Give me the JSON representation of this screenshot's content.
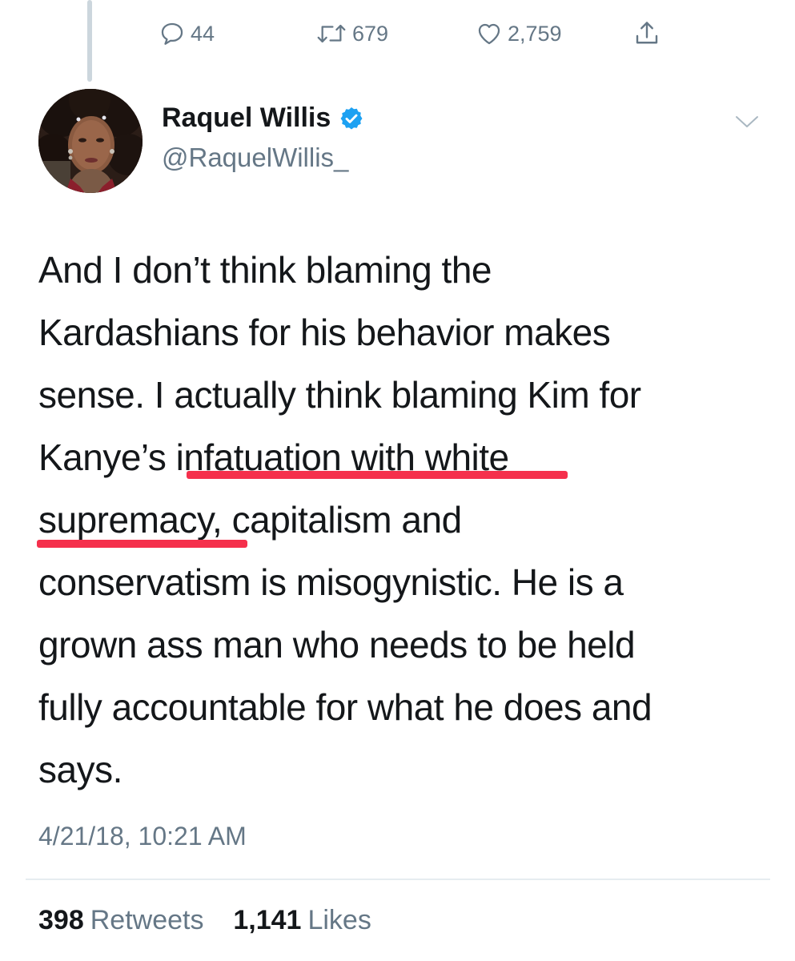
{
  "previous_tweet": {
    "actions": {
      "reply_count": "44",
      "retweet_count": "679",
      "like_count": "2,759"
    }
  },
  "tweet": {
    "author": {
      "name": "Raquel Willis",
      "handle": "@RaquelWillis_",
      "verified": true
    },
    "text_lines": [
      "And I don’t think blaming the",
      "Kardashians for his behavior makes",
      "sense. I actually think blaming Kim for",
      "Kanye’s infatuation with white",
      "supremacy, capitalism and",
      "conservatism is misogynistic. He is a",
      "grown ass man who needs to be held",
      "fully accountable for what he does and",
      "says."
    ],
    "highlighted_phrase": "infatuation with white supremacy,",
    "timestamp": "4/21/18, 10:21 AM",
    "stats": {
      "retweets_count": "398",
      "retweets_label": "Retweets",
      "likes_count": "1,141",
      "likes_label": "Likes"
    }
  },
  "colors": {
    "text": "#14171a",
    "secondary": "#657786",
    "verified": "#1da1f2",
    "underline": "#f5304c",
    "thread_line": "#ccd6dd"
  }
}
